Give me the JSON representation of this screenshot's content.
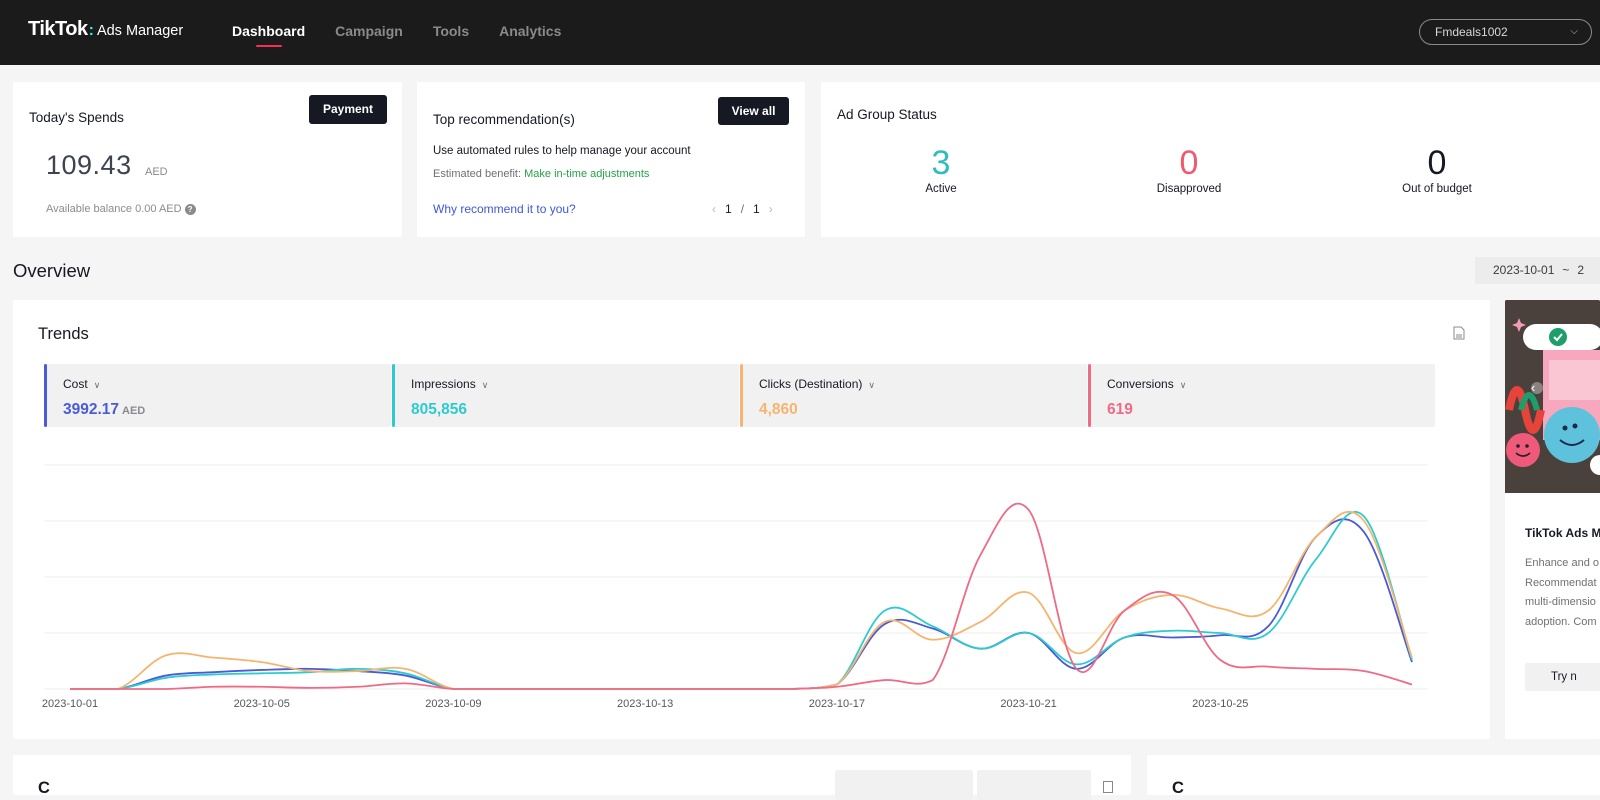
{
  "header": {
    "brand": "TikTok",
    "brand_separator": ":",
    "product": "Ads Manager",
    "nav": [
      {
        "label": "Dashboard",
        "active": true
      },
      {
        "label": "Campaign",
        "active": false
      },
      {
        "label": "Tools",
        "active": false
      },
      {
        "label": "Analytics",
        "active": false
      }
    ],
    "account": "Fmdeals1002",
    "account_icon": "chevron-down-icon"
  },
  "spends": {
    "title": "Today's Spends",
    "button": "Payment",
    "amount": "109.43",
    "currency": "AED",
    "balance_text": "Available balance 0.00 AED",
    "help_icon": "question-circle-icon"
  },
  "recommendation": {
    "title": "Top recommendation(s)",
    "button": "View all",
    "description": "Use automated rules to help manage your account",
    "benefit_label": "Estimated benefit: ",
    "benefit_value": "Make in-time adjustments",
    "why_link": "Why recommend it to you?",
    "page_current": "1",
    "page_separator": "/",
    "page_total": "1"
  },
  "ad_group_status": {
    "title": "Ad Group Status",
    "stats": [
      {
        "value": "3",
        "label": "Active",
        "color": "#2fbcbc"
      },
      {
        "value": "0",
        "label": "Disapproved",
        "color": "#ef5a6f"
      },
      {
        "value": "0",
        "label": "Out of budget",
        "color": "#161823"
      }
    ]
  },
  "overview": {
    "title": "Overview",
    "date_start": "2023-10-01",
    "date_separator": "~",
    "date_end_partial": "2"
  },
  "trends": {
    "title": "Trends",
    "export_icon": "export-file-icon",
    "metrics": [
      {
        "label": "Cost",
        "value": "3992.17",
        "unit": "AED",
        "color": "#4a5bd8"
      },
      {
        "label": "Impressions",
        "value": "805,856",
        "unit": "",
        "color": "#2dcbd0"
      },
      {
        "label": "Clicks (Destination)",
        "value": "4,860",
        "unit": "",
        "color": "#f6b56f"
      },
      {
        "label": "Conversions",
        "value": "619",
        "unit": "",
        "color": "#ef6a85"
      }
    ]
  },
  "promo": {
    "title": "TikTok Ads M",
    "body": [
      "Enhance and o",
      "Recommendat",
      "multi-dimensio",
      "adoption. Com"
    ],
    "button": "Try n",
    "carousel_prev_icon": "chevron-left-icon"
  },
  "bottom": {
    "left_title": "C",
    "right_title": "C"
  },
  "chart_data": {
    "type": "line",
    "title": "Trends",
    "normalized": true,
    "x": [
      "2023-10-01",
      "2023-10-02",
      "2023-10-03",
      "2023-10-04",
      "2023-10-05",
      "2023-10-06",
      "2023-10-07",
      "2023-10-08",
      "2023-10-09",
      "2023-10-10",
      "2023-10-11",
      "2023-10-12",
      "2023-10-13",
      "2023-10-14",
      "2023-10-15",
      "2023-10-16",
      "2023-10-17",
      "2023-10-18",
      "2023-10-19",
      "2023-10-20",
      "2023-10-21",
      "2023-10-22",
      "2023-10-23",
      "2023-10-24",
      "2023-10-25",
      "2023-10-26",
      "2023-10-27",
      "2023-10-28",
      "2023-10-29"
    ],
    "x_tick_labels": [
      "2023-10-01",
      "2023-10-05",
      "2023-10-09",
      "2023-10-13",
      "2023-10-17",
      "2023-10-21",
      "2023-10-25"
    ],
    "ylim": [
      0,
      1
    ],
    "grid": true,
    "legend": "metric cards above chart",
    "series": [
      {
        "name": "Cost",
        "color": "#4a5bd8",
        "values": [
          0,
          0,
          0.06,
          0.075,
          0.085,
          0.09,
          0.08,
          0.06,
          0,
          0,
          0,
          0,
          0,
          0,
          0,
          0,
          0.02,
          0.29,
          0.27,
          0.18,
          0.25,
          0.09,
          0.23,
          0.23,
          0.24,
          0.28,
          0.68,
          0.7,
          0.12
        ]
      },
      {
        "name": "Impressions",
        "color": "#2dcbd0",
        "values": [
          0,
          0,
          0.05,
          0.065,
          0.07,
          0.075,
          0.09,
          0.07,
          0,
          0,
          0,
          0,
          0,
          0,
          0,
          0,
          0.02,
          0.35,
          0.28,
          0.18,
          0.25,
          0.11,
          0.23,
          0.26,
          0.25,
          0.25,
          0.58,
          0.77,
          0.13
        ]
      },
      {
        "name": "Clicks (Destination)",
        "color": "#f6b56f",
        "values": [
          0,
          0,
          0.15,
          0.14,
          0.12,
          0.08,
          0.08,
          0.09,
          0,
          0,
          0,
          0,
          0,
          0,
          0,
          0,
          0.02,
          0.3,
          0.22,
          0.3,
          0.43,
          0.16,
          0.35,
          0.42,
          0.36,
          0.35,
          0.68,
          0.75,
          0.14
        ]
      },
      {
        "name": "Conversions",
        "color": "#ef6a85",
        "values": [
          0,
          0,
          0,
          0.01,
          0.01,
          0.005,
          0.01,
          0.025,
          0,
          0,
          0,
          0,
          0,
          0,
          0,
          0,
          0.01,
          0.04,
          0.04,
          0.6,
          0.8,
          0.09,
          0.35,
          0.42,
          0.13,
          0.1,
          0.09,
          0.08,
          0.02
        ]
      }
    ]
  }
}
